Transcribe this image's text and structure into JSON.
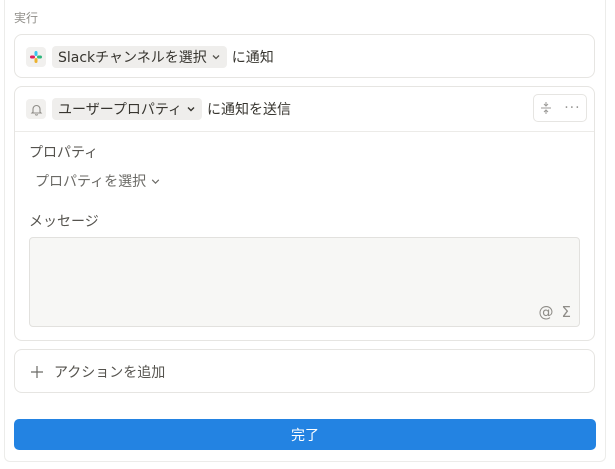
{
  "section": {
    "title": "実行"
  },
  "slack_step": {
    "icon": "slack-icon",
    "channel_select": "Slackチャンネルを選択",
    "suffix": "に通知"
  },
  "notify_step": {
    "icon": "bell-icon",
    "property_select": "ユーザープロパティ",
    "suffix": "に通知を送信",
    "property_label": "プロパティ",
    "property_placeholder": "プロパティを選択",
    "message_label": "メッセージ",
    "message_value": "",
    "message_tools": [
      "@",
      "Σ"
    ]
  },
  "add_action": {
    "label": "アクションを追加",
    "icon": "plus-icon"
  },
  "done_button": {
    "label": "完了"
  },
  "colors": {
    "primary": "#2383e2",
    "border": "#e6e5e2",
    "muted": "#8f8d88"
  }
}
